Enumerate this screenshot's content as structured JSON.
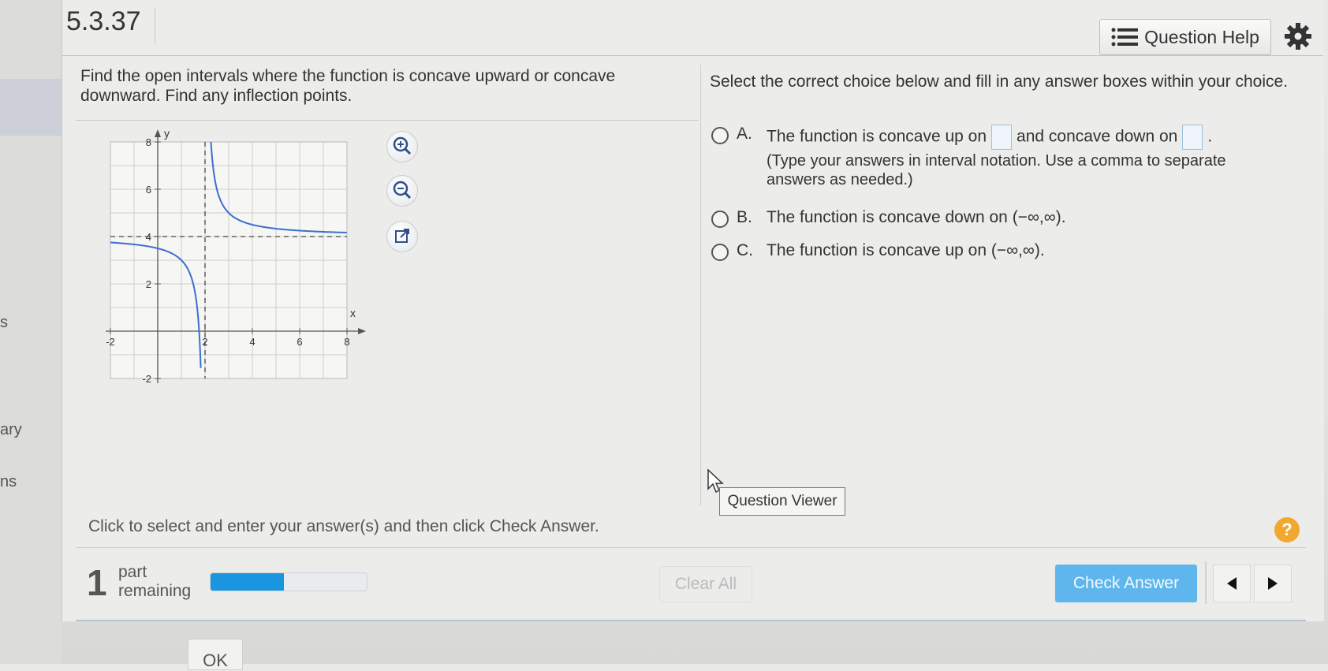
{
  "sidebar": {
    "fragments": [
      "s",
      "ary",
      "ns"
    ]
  },
  "question": {
    "id": "5.3.37",
    "help_label": "Question Help",
    "prompt": "Find the open intervals where the function is concave upward or concave downward. Find any inflection points."
  },
  "graph": {
    "y_axis_label": "y",
    "x_axis_label": "x",
    "x_ticks": [
      "-2",
      "2",
      "4",
      "6",
      "8"
    ],
    "y_ticks": [
      "8",
      "6",
      "4",
      "2",
      "-2"
    ],
    "vertical_asymptote_x": 2,
    "horizontal_asymptote_y": 4
  },
  "answer": {
    "instruction": "Select the correct choice below and fill in any answer boxes within your choice.",
    "choices": [
      {
        "letter": "A.",
        "text_before": "The function is concave up on",
        "text_middle": "and concave down on",
        "text_after": ".",
        "hint": "(Type your answers in interval notation. Use a comma to separate answers as needed.)"
      },
      {
        "letter": "B.",
        "text": "The function is concave down on (−∞,∞)."
      },
      {
        "letter": "C.",
        "text": "The function is concave up on (−∞,∞)."
      }
    ]
  },
  "tooltip": "Question Viewer",
  "footer": {
    "instruction": "Click to select and enter your answer(s) and then click Check Answer.",
    "help_symbol": "?",
    "parts_count": "1",
    "parts_label_1": "part",
    "parts_label_2": "remaining",
    "progress": 0.47,
    "clear_label": "Clear All",
    "check_label": "Check Answer",
    "ok_label": "OK"
  },
  "colors": {
    "accent": "#1a95e0",
    "check_button": "#5fb6ec",
    "curve": "#3b6fd0",
    "help": "#f0a830"
  }
}
